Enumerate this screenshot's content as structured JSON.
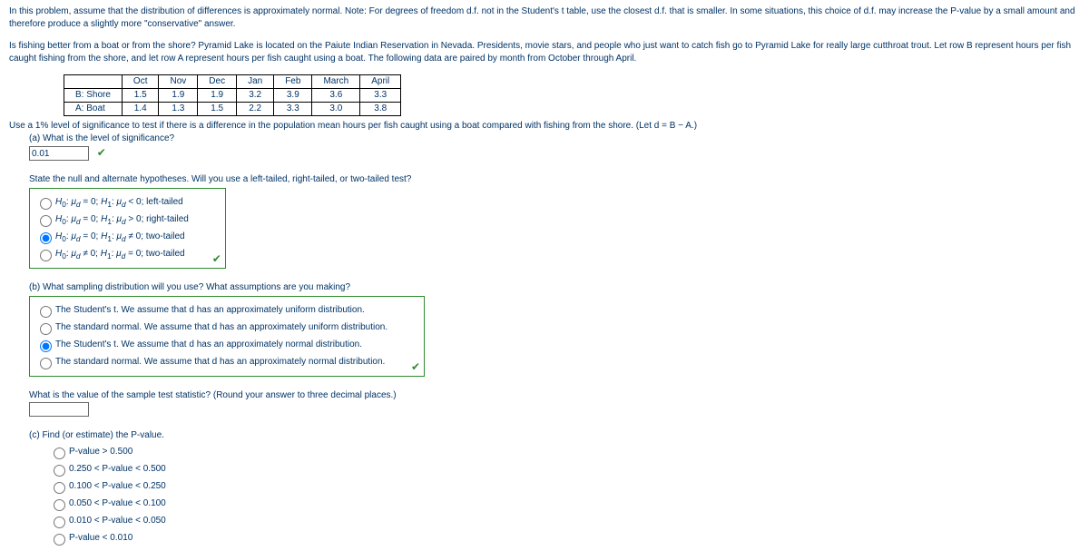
{
  "intro_note": "In this problem, assume that the distribution of differences is approximately normal. Note: For degrees of freedom d.f. not in the Student's t table, use the closest d.f. that is smaller. In some situations, this choice of d.f. may increase the P-value by a small amount and therefore produce a slightly more \"conservative\" answer.",
  "context": "Is fishing better from a boat or from the shore? Pyramid Lake is located on the Paiute Indian Reservation in Nevada. Presidents, movie stars, and people who just want to catch fish go to Pyramid Lake for really large cutthroat trout. Let row B represent hours per fish caught fishing from the shore, and let row A represent hours per fish caught using a boat. The following data are paired by month from October through April.",
  "table": {
    "headers": [
      "",
      "Oct",
      "Nov",
      "Dec",
      "Jan",
      "Feb",
      "March",
      "April"
    ],
    "rows": [
      {
        "label": "B: Shore",
        "vals": [
          "1.5",
          "1.9",
          "1.9",
          "3.2",
          "3.9",
          "3.6",
          "3.3"
        ]
      },
      {
        "label": "A: Boat",
        "vals": [
          "1.4",
          "1.3",
          "1.5",
          "2.2",
          "3.3",
          "3.0",
          "3.8"
        ]
      }
    ]
  },
  "use_line": "Use a 1% level of significance to test if there is a difference in the population mean hours per fish caught using a boat compared with fishing from the shore. (Let d = B − A.)",
  "partA": {
    "q": "(a) What is the level of significance?",
    "value": "0.01",
    "hyp_q": "State the null and alternate hypotheses. Will you use a left-tailed, right-tailed, or two-tailed test?",
    "options": [
      "H₀: μ_d = 0; H₁: μ_d < 0; left-tailed",
      "H₀: μ_d = 0; H₁: μ_d > 0; right-tailed",
      "H₀: μ_d = 0; H₁: μ_d ≠ 0; two-tailed",
      "H₀: μ_d ≠ 0; H₁: μ_d = 0; two-tailed"
    ],
    "selected": 2
  },
  "partB": {
    "q": "(b) What sampling distribution will you use? What assumptions are you making?",
    "options": [
      "The Student's t. We assume that d has an approximately uniform distribution.",
      "The standard normal. We assume that d has an approximately uniform distribution.",
      "The Student's t. We assume that d has an approximately normal distribution.",
      "The standard normal. We assume that d has an approximately normal distribution."
    ],
    "selected": 2,
    "stat_q": "What is the value of the sample test statistic? (Round your answer to three decimal places.)"
  },
  "partC": {
    "q": "(c) Find (or estimate) the P-value.",
    "options": [
      "P-value > 0.500",
      "0.250 < P-value < 0.500",
      "0.100 < P-value < 0.250",
      "0.050 < P-value < 0.100",
      "0.010 < P-value < 0.050",
      "P-value < 0.010"
    ]
  }
}
